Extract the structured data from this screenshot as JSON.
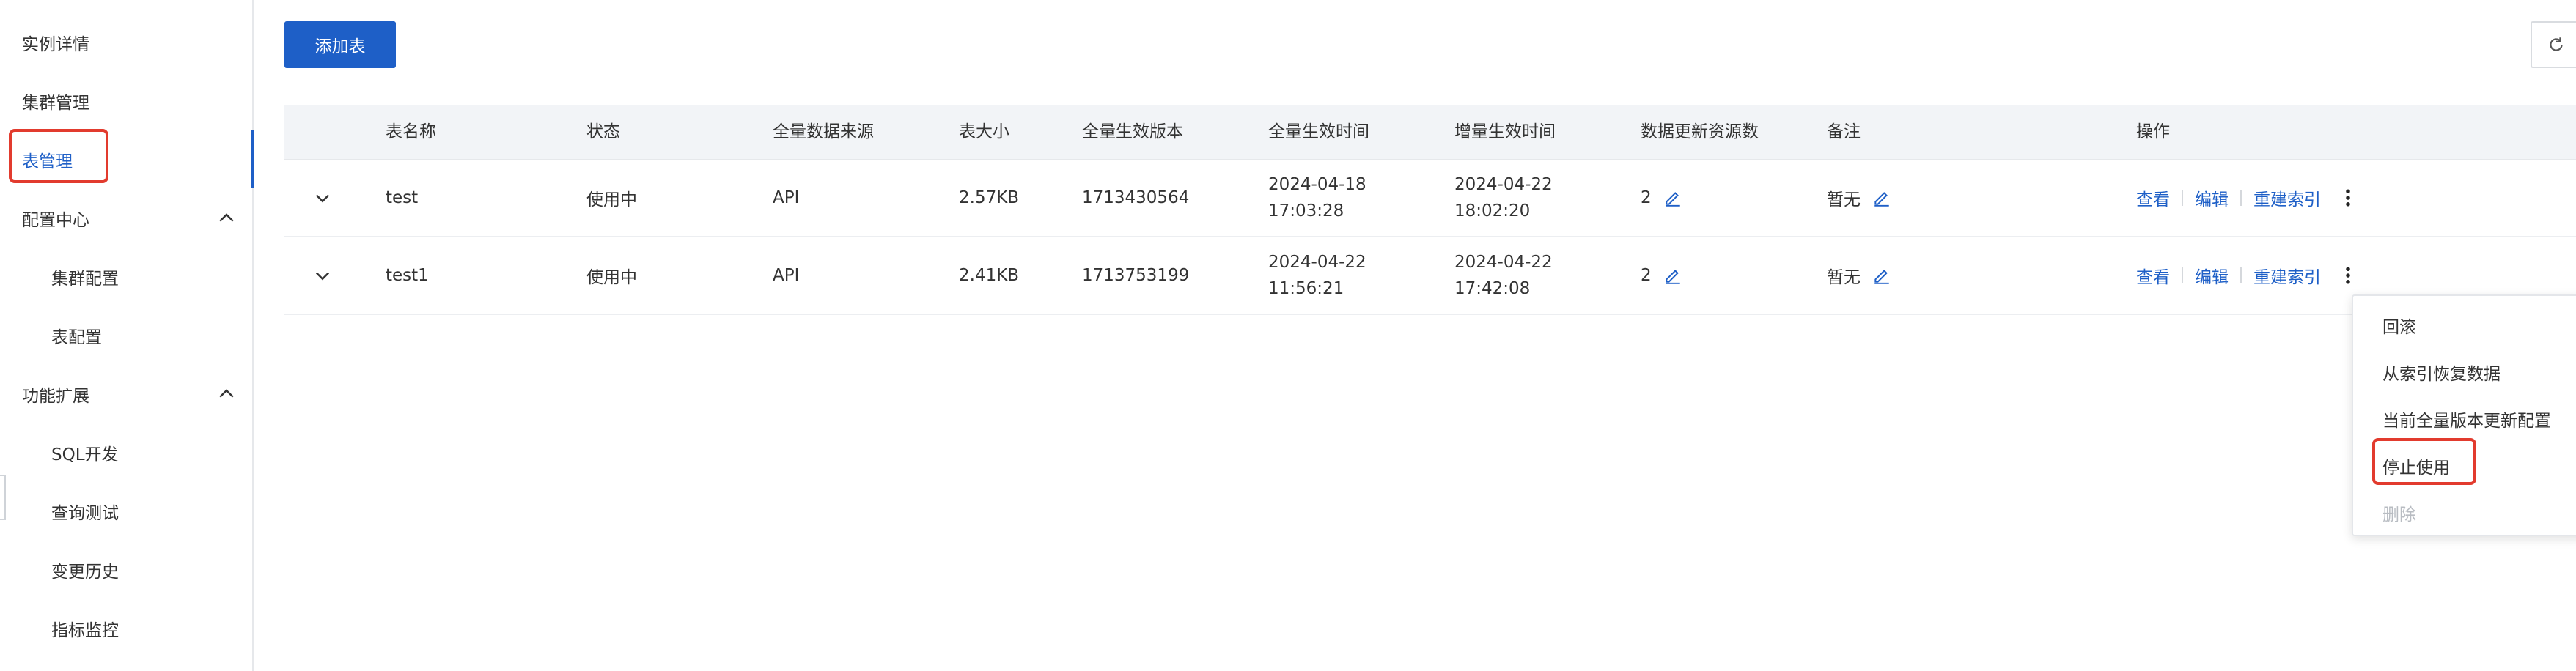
{
  "sidebar": {
    "items": [
      {
        "label": "实例详情"
      },
      {
        "label": "集群管理"
      },
      {
        "label": "表管理"
      },
      {
        "label": "配置中心"
      },
      {
        "label": "集群配置"
      },
      {
        "label": "表配置"
      },
      {
        "label": "功能扩展"
      },
      {
        "label": "SQL开发"
      },
      {
        "label": "查询测试"
      },
      {
        "label": "变更历史"
      },
      {
        "label": "指标监控"
      }
    ],
    "active": "表管理"
  },
  "toolbar": {
    "add_table_label": "添加表",
    "refresh_icon": "refresh-icon"
  },
  "table": {
    "headers": [
      "表名称",
      "状态",
      "全量数据来源",
      "表大小",
      "全量生效版本",
      "全量生效时间",
      "增量生效时间",
      "数据更新资源数",
      "备注",
      "操作"
    ],
    "rows": [
      {
        "name": "test",
        "status": "使用中",
        "source": "API",
        "size": "2.57KB",
        "version": "1713430564",
        "full_time": "2024-04-18 17:03:28",
        "incr_time": "2024-04-22 18:02:20",
        "resources": "2",
        "remark": "暂无"
      },
      {
        "name": "test1",
        "status": "使用中",
        "source": "API",
        "size": "2.41KB",
        "version": "1713753199",
        "full_time": "2024-04-22 11:56:21",
        "incr_time": "2024-04-22 17:42:08",
        "resources": "2",
        "remark": "暂无"
      }
    ],
    "actions": {
      "view": "查看",
      "edit": "编辑",
      "reindex": "重建索引"
    }
  },
  "dropdown": {
    "items": [
      {
        "label": "回滚"
      },
      {
        "label": "从索引恢复数据"
      },
      {
        "label": "当前全量版本更新配置"
      },
      {
        "label": "停止使用"
      },
      {
        "label": "删除"
      }
    ]
  },
  "colors": {
    "accent": "#1e5fc7",
    "highlight": "#e23b2e",
    "header_bg": "#f2f4f7"
  }
}
